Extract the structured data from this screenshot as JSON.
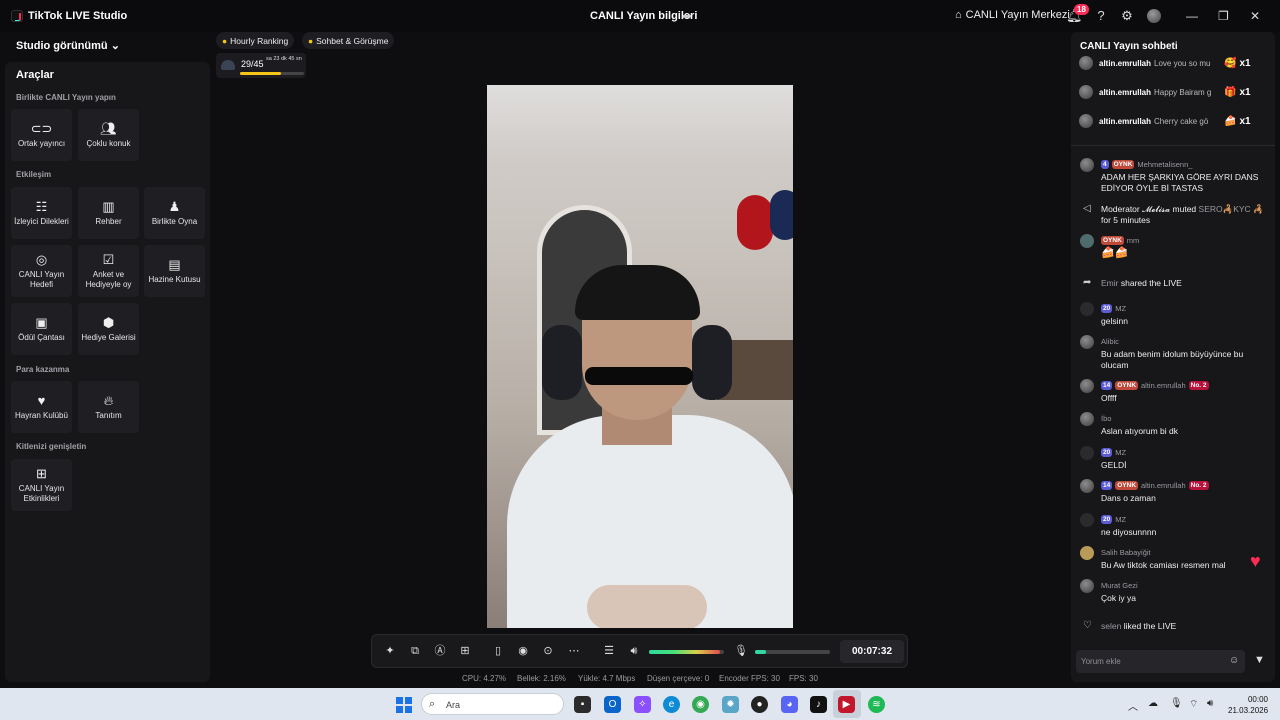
{
  "titlebar": {
    "app_title": "TikTok LIVE Studio",
    "live_info": "CANLI Yayın bilgileri",
    "center_link": "CANLI Yayın Merkezi",
    "notifications": "18"
  },
  "left": {
    "studio_view": "Studio görünümü",
    "tools_title": "Araçlar",
    "sections": {
      "together": "Birlikte CANLI Yayın yapın",
      "engagement": "Etkileşim",
      "monetize": "Para kazanma",
      "expand": "Kitlenizi genişletin"
    },
    "tools": {
      "co_host": "Ortak yayıncı",
      "multi_guest": "Çoklu konuk",
      "viewer_requests": "İzleyici Dilekleri",
      "guide": "Rehber",
      "play_together": "Birlikte Oyna",
      "live_goal": "CANLI Yayın Hedefi",
      "poll": "Anket ve Hediyeyle oy",
      "treasure": "Hazine Kutusu",
      "reward_bag": "Ödül Çantası",
      "gift_gallery": "Hediye Galerisi",
      "fan_club": "Hayran Kulübü",
      "promote": "Tanıtım",
      "live_events": "CANLI Yayın Etkinlikleri"
    }
  },
  "center": {
    "pills": {
      "ranking": "Hourly Ranking",
      "chat": "Sohbet & Görüşme"
    },
    "goal": {
      "count": "29/45",
      "time": "sa 23 dk 45 sn",
      "progress": 0.64
    },
    "volume_level": 0.95,
    "mic_level": 0.15,
    "timer": "00:07:32"
  },
  "stats": {
    "cpu": "CPU:  4.27%",
    "memory": "Bellek:  2.16%",
    "upload": "Yükle:  4.7 Mbps",
    "dropped": "Düşen çerçeve:  0",
    "encoder_fps": "Encoder FPS:  30",
    "fps": "FPS:  30"
  },
  "chat": {
    "title": "CANLI Yayın sohbeti",
    "gifts": [
      {
        "user": "altin.emrullah",
        "msg": "Love you so mu",
        "icon": "🥰",
        "mult": "x1"
      },
      {
        "user": "altin.emrullah",
        "msg": "Happy Bairam g",
        "icon": "🎁",
        "mult": "x1"
      },
      {
        "user": "altin.emrullah",
        "msg": "Cherry cake gö",
        "icon": "🍰",
        "mult": "x1"
      }
    ],
    "messages": {
      "m1_lvl": "4",
      "m1_oynk": "OYNK",
      "m1_user": "Mehmetalisenn_",
      "m1_text": "ADAM HER ŞARKIYA GÖRE AYRI DANS EDİYOR ÖYLE Bİ TASTAS",
      "m2_text_a": "Moderator",
      "m2_mod": "𝓜𝓮𝓵𝓲𝓼𝓪",
      "m2_text_b": "muted",
      "m2_target": "SERO🦂KYC",
      "m2_text_c": "🦂 for 5 minutes",
      "m3_oynk": "OYNK",
      "m3_user": "mm",
      "m3_text": "🍰🍰",
      "m4_user": "Emir",
      "m4_text": "shared the LIVE",
      "m5_lvl": "20",
      "m5_user": "MZ",
      "m5_text": "gelsinn",
      "m6_user": "Alibic",
      "m6_text": "Bu adam benim idolum büyüyünce bu olucam",
      "m7_lvl": "14",
      "m7_oynk": "OYNK",
      "m7_user": "altin.emrullah",
      "m7_no": "No. 2",
      "m7_text": "Offff",
      "m8_user": "İbo",
      "m8_text": "Aslan atıyorum bi dk",
      "m9_lvl": "20",
      "m9_user": "MZ",
      "m9_text": "GELDİ",
      "m10_lvl": "14",
      "m10_oynk": "OYNK",
      "m10_user": "altin.emrullah",
      "m10_no": "No. 2",
      "m10_text": "Dans o zaman",
      "m11_lvl": "20",
      "m11_user": "MZ",
      "m11_text": "ne diyosunnnn",
      "m12_user": "Salih Babayiğit",
      "m12_text": "Bu Aw tiktok camiası resmen mal",
      "m13_user": "Murat Gezi",
      "m13_text": "Çok iy ya",
      "m14_user": "selen",
      "m14_text": "liked the LIVE"
    },
    "comment_placeholder": "Yorum ekle"
  },
  "taskbar": {
    "search_placeholder": "Ara",
    "time": "00:00",
    "date": "21.03.2026"
  },
  "colors": {
    "accent": "#fe2c55",
    "teal": "#25f4ee",
    "panel": "#17171a"
  }
}
